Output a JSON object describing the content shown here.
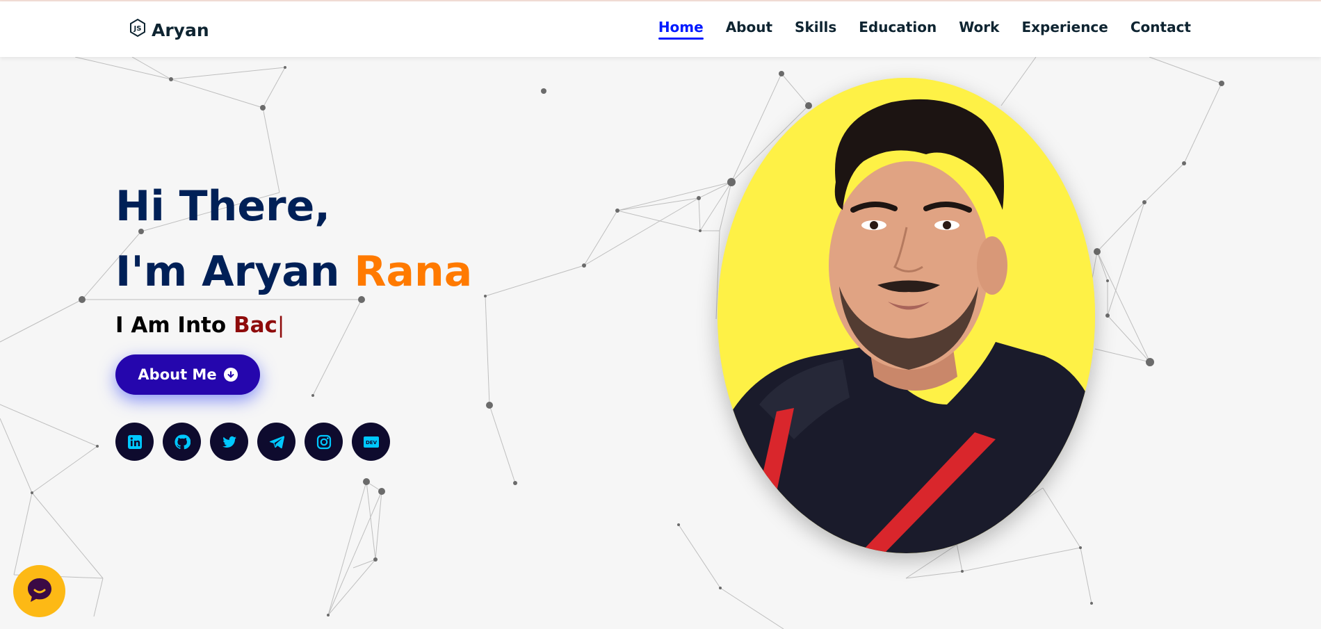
{
  "header": {
    "logo_text": "Aryan",
    "logo_icon": "nodejs-icon",
    "nav": [
      {
        "label": "Home",
        "active": true
      },
      {
        "label": "About",
        "active": false
      },
      {
        "label": "Skills",
        "active": false
      },
      {
        "label": "Education",
        "active": false
      },
      {
        "label": "Work",
        "active": false
      },
      {
        "label": "Experience",
        "active": false
      },
      {
        "label": "Contact",
        "active": false
      }
    ]
  },
  "hero": {
    "greeting": "Hi There,",
    "name_prefix": "I'm Aryan ",
    "name_highlight": "Rana",
    "into_prefix": "I Am Into ",
    "typed_text": "Bac",
    "cursor": "|",
    "about_button_label": "About Me",
    "socials": [
      {
        "name": "linkedin-icon"
      },
      {
        "name": "github-icon"
      },
      {
        "name": "twitter-icon"
      },
      {
        "name": "telegram-icon"
      },
      {
        "name": "instagram-icon"
      },
      {
        "name": "dev-icon",
        "label": "DEV"
      }
    ]
  },
  "colors": {
    "nav_active": "#011aff",
    "title": "#002057",
    "highlight": "#ff7a00",
    "typed": "#8e0b0b",
    "button": "#2506ad",
    "social_bg": "#0e0b2e",
    "social_icon": "#00c8ff",
    "photo_bg": "#fef146",
    "chat_bg": "#fdb915"
  },
  "chat_widget": {
    "icon": "chat-icon"
  }
}
